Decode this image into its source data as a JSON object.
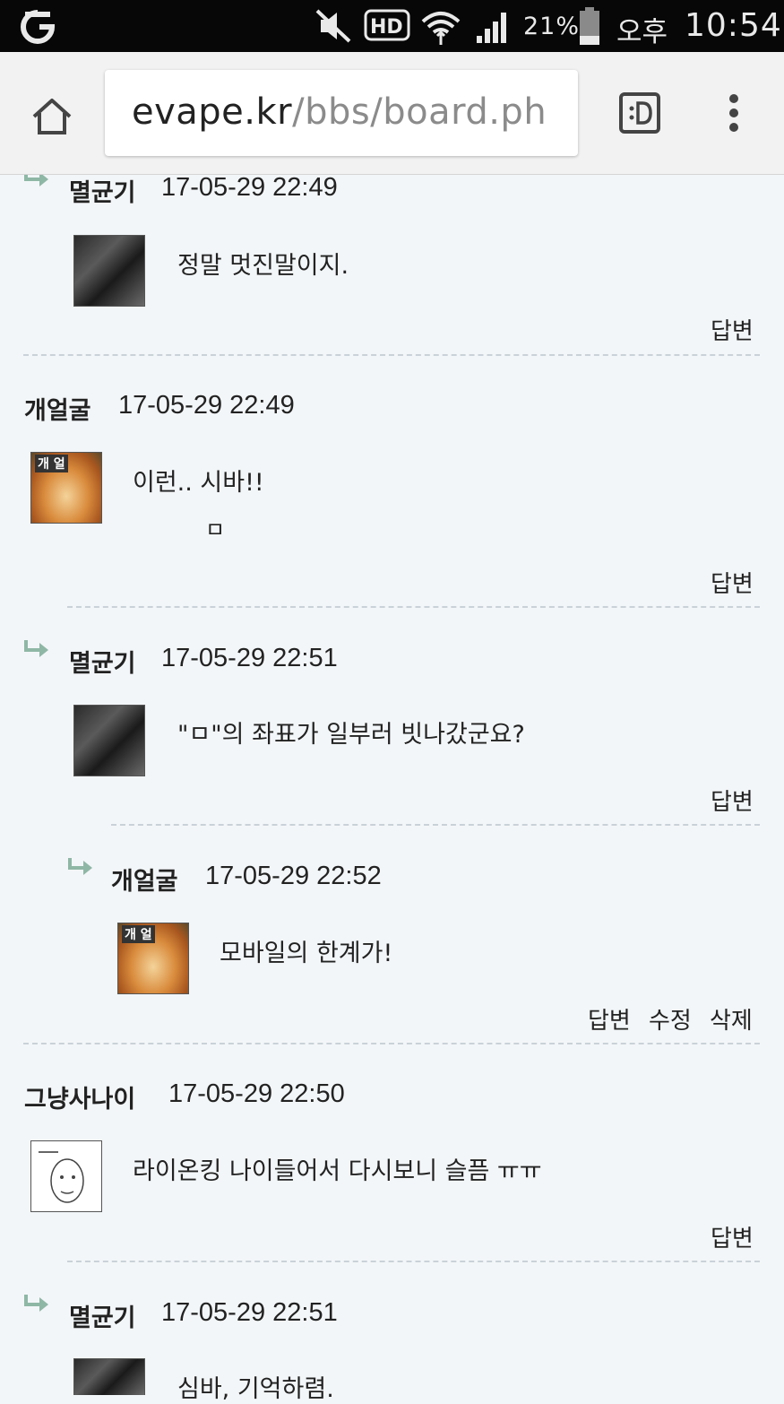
{
  "status_bar": {
    "battery": "21%",
    "ampm": "오후",
    "time": "10:54"
  },
  "browser": {
    "url_domain": "evape.kr",
    "url_path": "/bbs/board.ph"
  },
  "comments": [
    {
      "author": "멸균기",
      "date": "17-05-29 22:49",
      "text": "정말 멋진말이지.",
      "actions": [
        "답변"
      ],
      "avatar": "avatar-person"
    },
    {
      "author": "개얼굴",
      "date": "17-05-29 22:49",
      "text": "이런.. 시바!!",
      "text2": "ㅁ",
      "actions": [
        "답변"
      ],
      "avatar": "avatar-dog",
      "avatar_text": "개 얼"
    },
    {
      "author": "멸균기",
      "date": "17-05-29 22:51",
      "text": "\"ㅁ\"의 좌표가 일부러 빗나갔군요?",
      "actions": [
        "답변"
      ],
      "avatar": "avatar-person"
    },
    {
      "author": "개얼굴",
      "date": "17-05-29 22:52",
      "text": "모바일의 한계가!",
      "actions": [
        "답변",
        "수정",
        "삭제"
      ],
      "avatar": "avatar-dog",
      "avatar_text": "개 얼"
    },
    {
      "author": "그냥사나이",
      "date": "17-05-29 22:50",
      "text": "라이온킹 나이들어서 다시보니 슬픔 ㅠㅠ",
      "actions": [
        "답변"
      ],
      "avatar": "avatar-drawing"
    },
    {
      "author": "멸균기",
      "date": "17-05-29 22:51",
      "text": "심바, 기억하렴.",
      "actions": [],
      "avatar": "avatar-person"
    }
  ],
  "icons": {
    "reply_arrow": "reply-arrow-icon",
    "home": "home-icon",
    "reader": "reader-mode-icon",
    "menu": "overflow-menu-icon"
  },
  "colors": {
    "background": "#f3f6f8",
    "arrow": "#8fb7a6",
    "divider": "#c9d2d8"
  }
}
